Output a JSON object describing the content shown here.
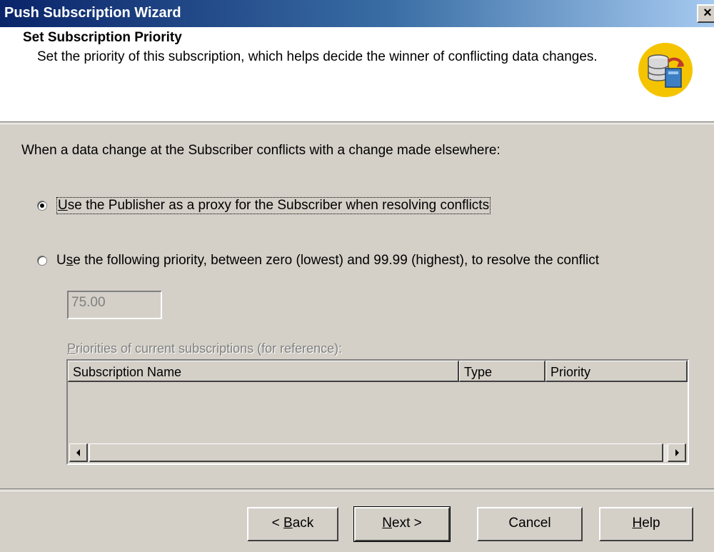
{
  "window": {
    "title": "Push Subscription Wizard",
    "close_glyph": "×"
  },
  "header": {
    "title": "Set Subscription Priority",
    "description": "Set the priority of this subscription, which helps decide the winner of conflicting data changes.",
    "icon": "database-sync-icon"
  },
  "intro": "When a data change at the Subscriber conflicts with a change made elsewhere:",
  "options": [
    {
      "label_pre": "",
      "label_key": "U",
      "label_post": "se the Publisher as a proxy for the Subscriber when resolving conflicts",
      "selected": true
    },
    {
      "label_pre": "U",
      "label_key": "s",
      "label_post": "e the following priority, between zero (lowest) and 99.99 (highest), to resolve the conflict",
      "selected": false
    }
  ],
  "priority": {
    "value": "75.00",
    "disabled": true
  },
  "reference": {
    "label_key": "P",
    "label_post": "riorities of current subscriptions (for reference):",
    "columns": [
      "Subscription Name",
      "Type",
      "Priority"
    ],
    "rows": []
  },
  "buttons": {
    "back_pre": "< ",
    "back_key": "B",
    "back_post": "ack",
    "next_key": "N",
    "next_post": "ext >",
    "cancel": "Cancel",
    "help_key": "H",
    "help_post": "elp"
  },
  "colors": {
    "titlebar_start": "#0a246a",
    "titlebar_end": "#a6caf0",
    "dialog_face": "#d4d0c8",
    "disabled_text": "#808080"
  }
}
